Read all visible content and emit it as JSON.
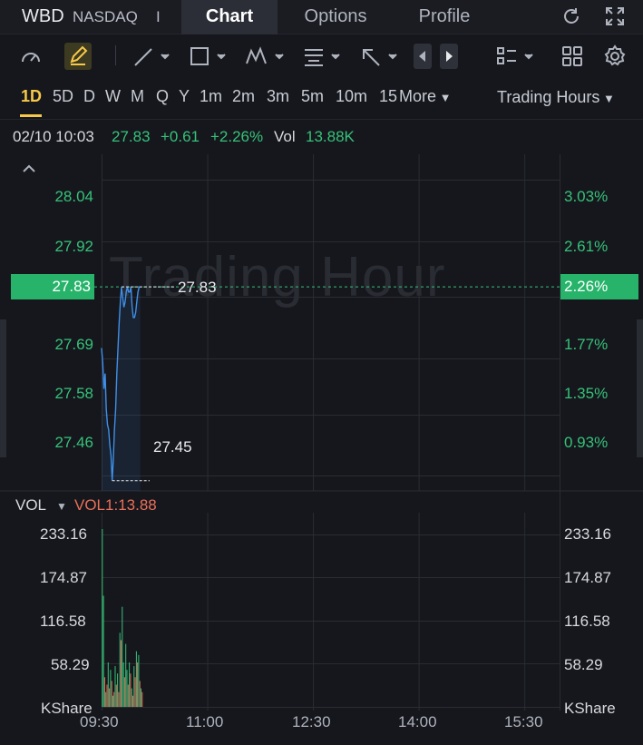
{
  "header": {
    "ticker": "WBD",
    "exchange": "NASDAQ",
    "separator": "I",
    "tabs": [
      {
        "label": "Chart",
        "active": true
      },
      {
        "label": "Options",
        "active": false
      },
      {
        "label": "Profile",
        "active": false
      }
    ],
    "icons": [
      "refresh-icon",
      "fullscreen-icon"
    ]
  },
  "toolbar": {
    "icons": [
      "gauge-icon",
      "draw-pencil-icon",
      "trend-line-icon",
      "rectangle-icon",
      "pattern-icon",
      "text-note-icon",
      "arrow-icon",
      "scroll-left-icon",
      "scroll-right-icon",
      "indicator-list-icon",
      "layout-grid-icon",
      "settings-gear-icon"
    ]
  },
  "periods": [
    "1D",
    "5D",
    "D",
    "W",
    "M",
    "Q",
    "Y",
    "1m",
    "2m",
    "3m",
    "5m",
    "10m",
    "15",
    "More"
  ],
  "active_period": "1D",
  "session_selector": "Trading Hours",
  "quote": {
    "datetime": "02/10 10:03",
    "price": "27.83",
    "change": "+0.61",
    "change_pct": "+2.26%",
    "vol_label": "Vol",
    "volume": "13.88K"
  },
  "watermark": "Trading Hour",
  "colors": {
    "up": "#35c27a",
    "down": "#e8705a",
    "line": "#3f8fe8",
    "accent": "#f7c948"
  },
  "chart_data": {
    "type": "line",
    "price_axis_left": [
      "28.04",
      "27.92",
      "27.81",
      "27.69",
      "27.58",
      "27.46"
    ],
    "price_axis_right": [
      "3.03%",
      "2.61%",
      "2.19%",
      "1.77%",
      "1.35%",
      "0.93%"
    ],
    "last_price_tag": "27.83",
    "last_pct_tag": "2.26%",
    "high_label": "27.83",
    "low_label": "27.45",
    "ylim": [
      27.43,
      28.09
    ],
    "x_time": [
      "09:30",
      "11:00",
      "12:30",
      "14:00",
      "15:30"
    ],
    "session_minutes": [
      0,
      390
    ],
    "price_series": {
      "minutes": [
        0,
        1,
        2,
        3,
        4,
        5,
        6,
        7,
        8,
        9,
        10,
        11,
        12,
        13,
        14,
        15,
        16,
        17,
        18,
        19,
        20,
        21,
        22,
        23,
        24,
        25,
        26,
        27,
        28,
        29,
        30,
        31,
        32,
        33
      ],
      "values": [
        27.71,
        27.68,
        27.63,
        27.66,
        27.59,
        27.56,
        27.55,
        27.52,
        27.5,
        27.45,
        27.49,
        27.55,
        27.59,
        27.66,
        27.71,
        27.76,
        27.8,
        27.83,
        27.81,
        27.79,
        27.8,
        27.82,
        27.83,
        27.82,
        27.82,
        27.83,
        27.79,
        27.77,
        27.77,
        27.78,
        27.8,
        27.82,
        27.83,
        27.83
      ]
    },
    "volume_panel": {
      "label": "VOL",
      "indicator": "VOL1:13.88",
      "axis": [
        "233.16",
        "174.87",
        "116.58",
        "58.29"
      ],
      "unit": "KShare",
      "ylim": [
        0,
        262
      ],
      "values": [
        240,
        150,
        40,
        20,
        30,
        60,
        25,
        50,
        35,
        15,
        20,
        55,
        30,
        45,
        20,
        100,
        90,
        135,
        60,
        40,
        85,
        50,
        30,
        60,
        45,
        25,
        15,
        55,
        40,
        75,
        60,
        70,
        35,
        25,
        20
      ],
      "up": [
        true,
        true,
        false,
        true,
        false,
        true,
        false,
        true,
        false,
        true,
        false,
        true,
        false,
        true,
        false,
        true,
        false,
        true,
        true,
        false,
        true,
        true,
        false,
        true,
        false,
        true,
        false,
        true,
        false,
        true,
        false,
        true,
        false,
        true,
        false
      ]
    }
  }
}
